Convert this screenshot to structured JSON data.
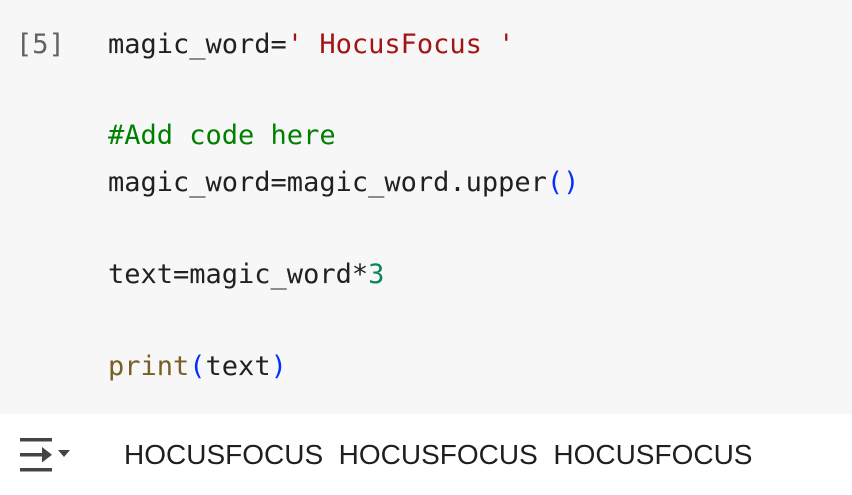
{
  "cell": {
    "execution_count": "[5]",
    "code": {
      "line1": {
        "var": "magic_word=",
        "string": "' HocusFocus '"
      },
      "line2": {
        "comment": "#Add code here"
      },
      "line3": {
        "prefix": "magic_word=magic_word.upper",
        "open_paren": "(",
        "close_paren": ")"
      },
      "line4": {
        "prefix": "text=magic_word*",
        "number": "3"
      },
      "line5": {
        "builtin": "print",
        "open_paren": "(",
        "arg": "text",
        "close_paren": ")"
      }
    },
    "output": {
      "toggle_icon": "output-collapse-icon",
      "text": "HOCUSFOCUS  HOCUSFOCUS  HOCUSFOCUS"
    }
  },
  "colors": {
    "code_background": "#f7f7f7",
    "string": "#a31515",
    "comment": "#008000",
    "number": "#098658",
    "builtin": "#795e26",
    "paren": "#0431fa",
    "execution_count": "#616161"
  }
}
